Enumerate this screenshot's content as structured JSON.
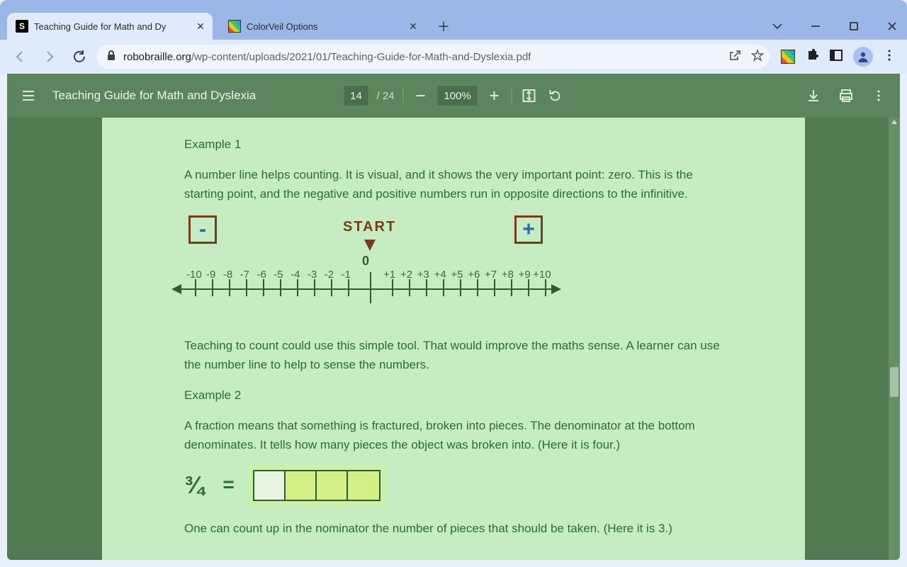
{
  "browser": {
    "tabs": [
      {
        "title": "Teaching Guide for Math and Dy",
        "active": true,
        "favicon": "s"
      },
      {
        "title": "ColorVeil Options",
        "active": false,
        "favicon": "cv"
      }
    ],
    "url_host": "robobraille.org",
    "url_path": "/wp-content/uploads/2021/01/Teaching-Guide-for-Math-and-Dyslexia.pdf"
  },
  "pdf": {
    "title": "Teaching Guide for Math and Dyslexia",
    "page_current": "14",
    "page_total": "/ 24",
    "zoom": "100%"
  },
  "doc": {
    "ex1_heading": "Example 1",
    "ex1_p1": "A number line helps counting. It is visual, and it shows the very important point: zero. This is the starting point, and the negative and positive numbers run in opposite directions to the infinitive.",
    "numline": {
      "start_label": "START",
      "zero_label": "0",
      "minus_box": "-",
      "plus_box": "+",
      "neg": [
        "-10",
        "-9",
        "-8",
        "-7",
        "-6",
        "-5",
        "-4",
        "-3",
        "-2",
        "-1"
      ],
      "pos": [
        "+1",
        "+2",
        "+3",
        "+4",
        "+5",
        "+6",
        "+7",
        "+8",
        "+9",
        "+10"
      ]
    },
    "ex1_p2": "Teaching to count could use this simple tool. That would improve the maths sense. A learner can use the number line to help to sense the numbers.",
    "ex2_heading": "Example 2",
    "ex2_p1": "A fraction means that something is fractured, broken into pieces. The denominator at the bottom denominates. It tells how many pieces the object was broken into. (Here it is four.)",
    "fraction_symbol": "¾",
    "equals": "=",
    "ex2_p2": "One can count up in the nominator the number of pieces that should be taken. (Here it is 3.)"
  }
}
